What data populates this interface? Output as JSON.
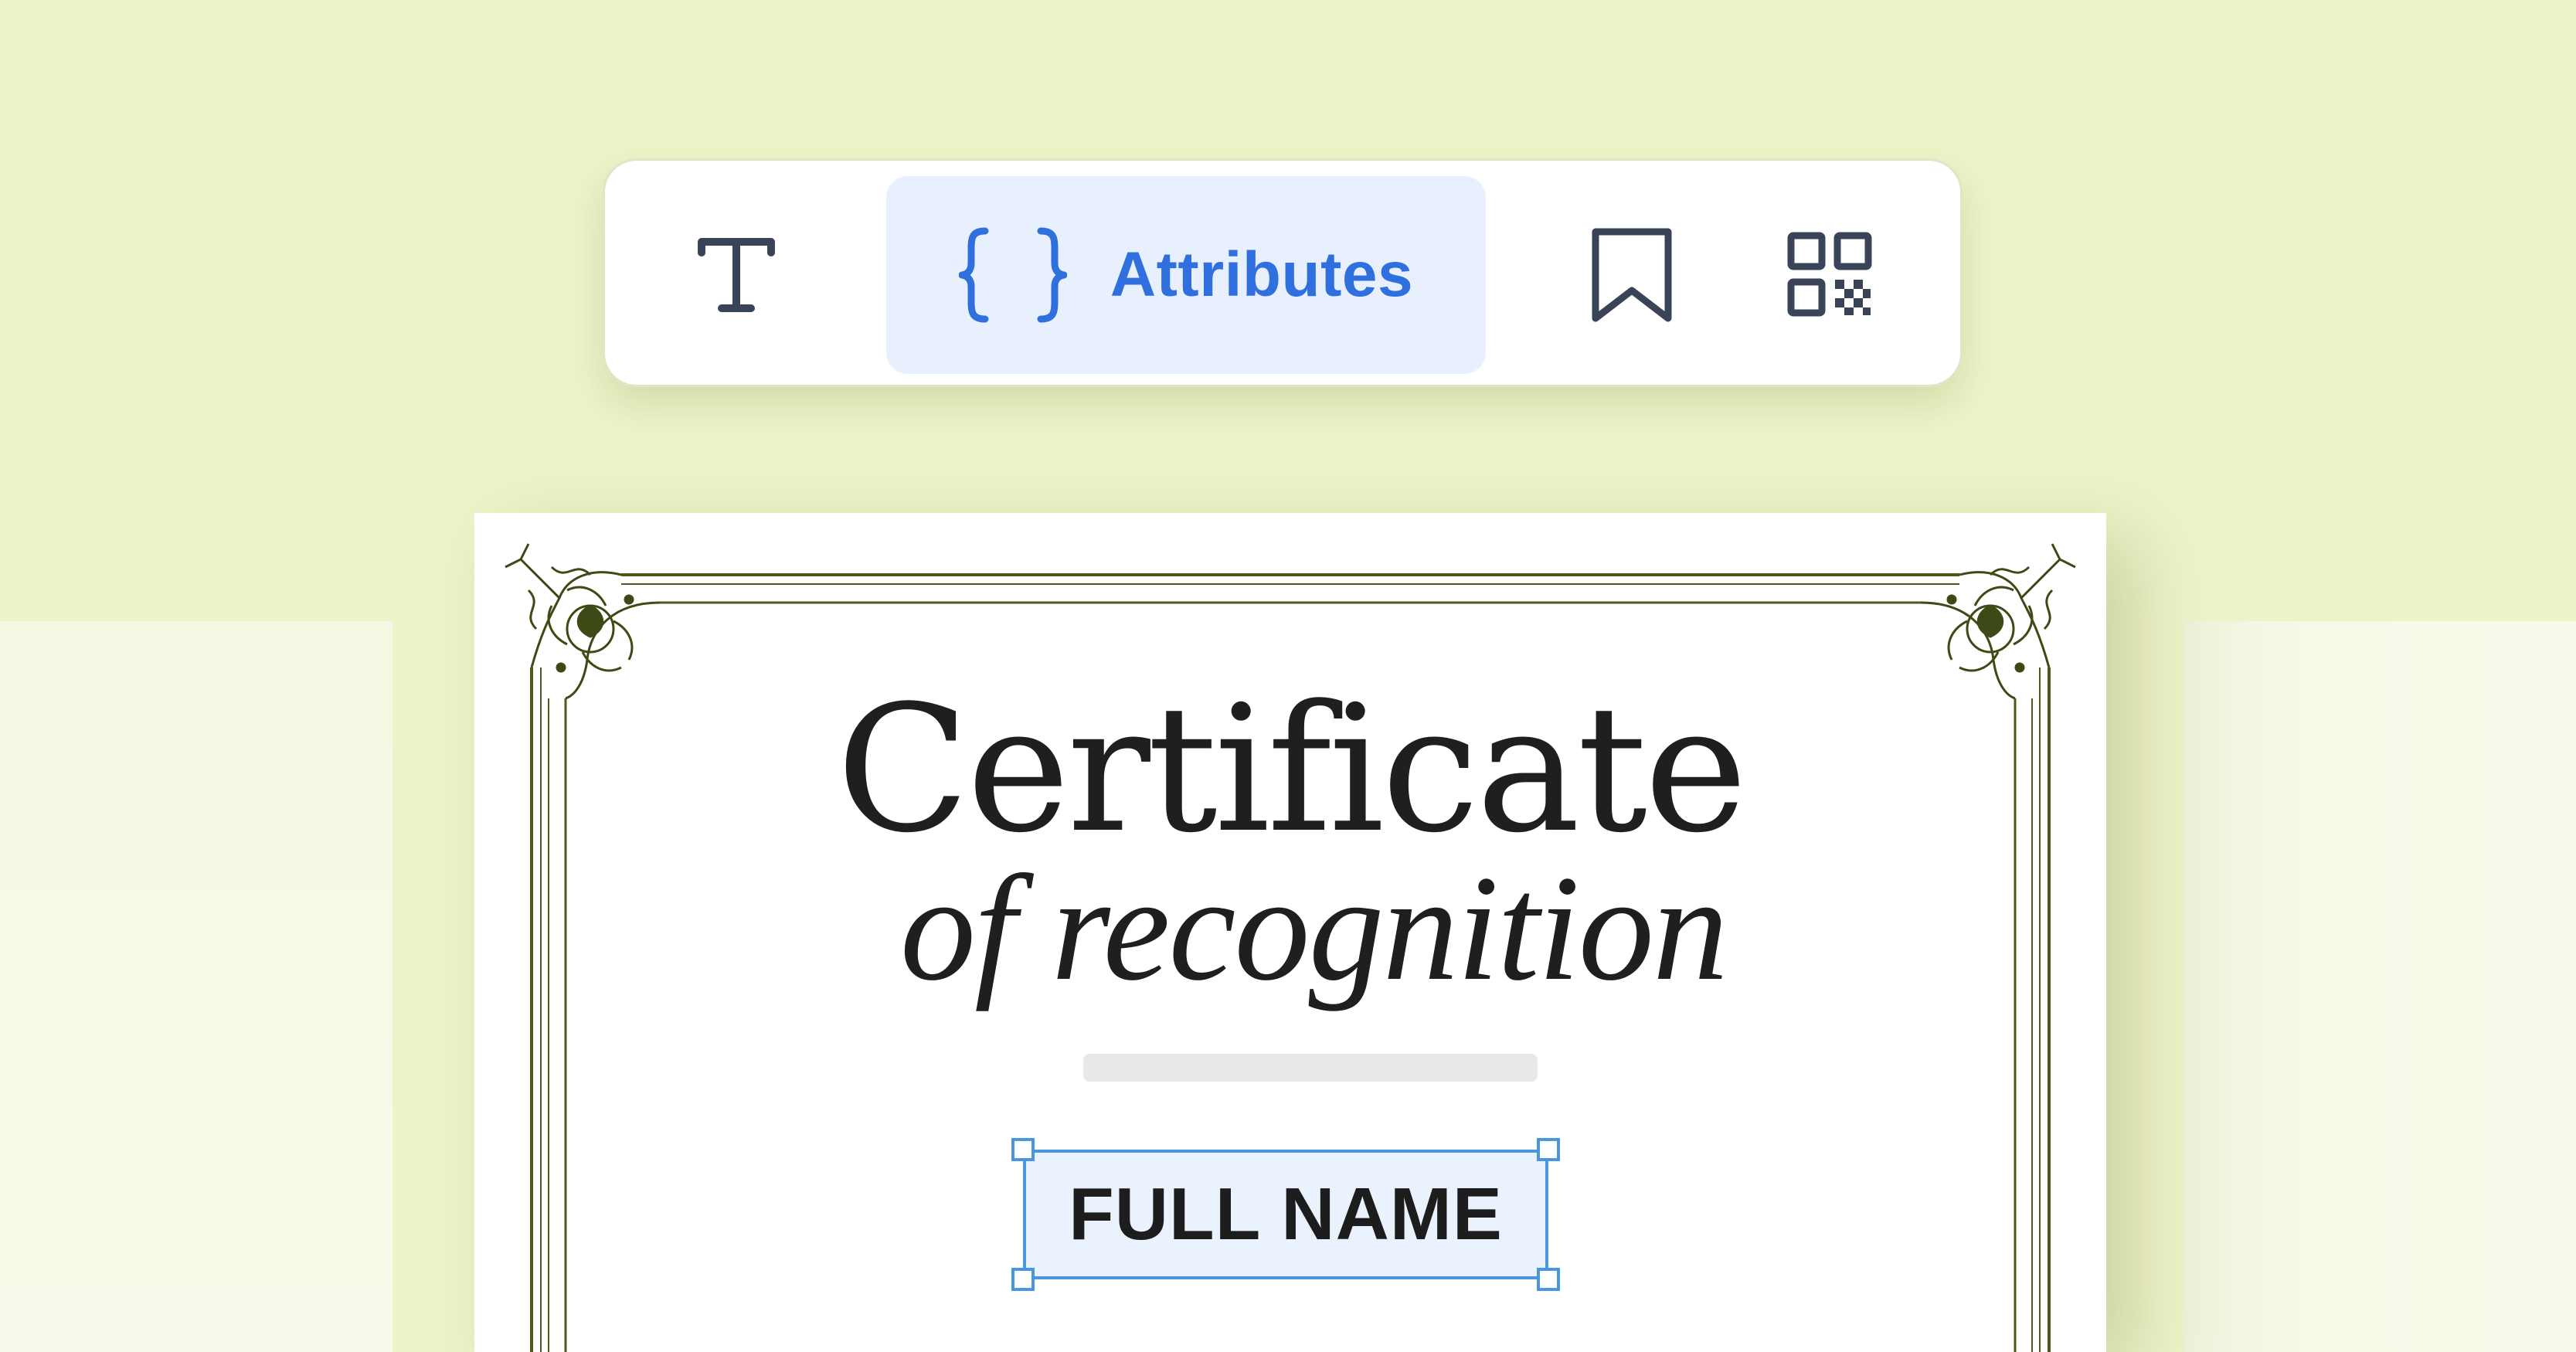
{
  "toolbar": {
    "text_tool_icon": "text-t-icon",
    "attributes_icon": "curly-braces-icon",
    "attributes_label": "Attributes",
    "bookmark_icon": "bookmark-icon",
    "qr_icon": "qr-code-icon",
    "selected_tool": "Attributes"
  },
  "certificate": {
    "title": "Certificate",
    "subtitle": "of recognition",
    "name_field_text": "FULL NAME"
  },
  "colors": {
    "background": "#eef3c9",
    "accent": "#2f6fde",
    "selected_tab_bg": "#e7f0fc",
    "selection_outline": "#4a97e0",
    "frame_olive": "#4c5a1c",
    "icon_dark": "#3a4458"
  }
}
